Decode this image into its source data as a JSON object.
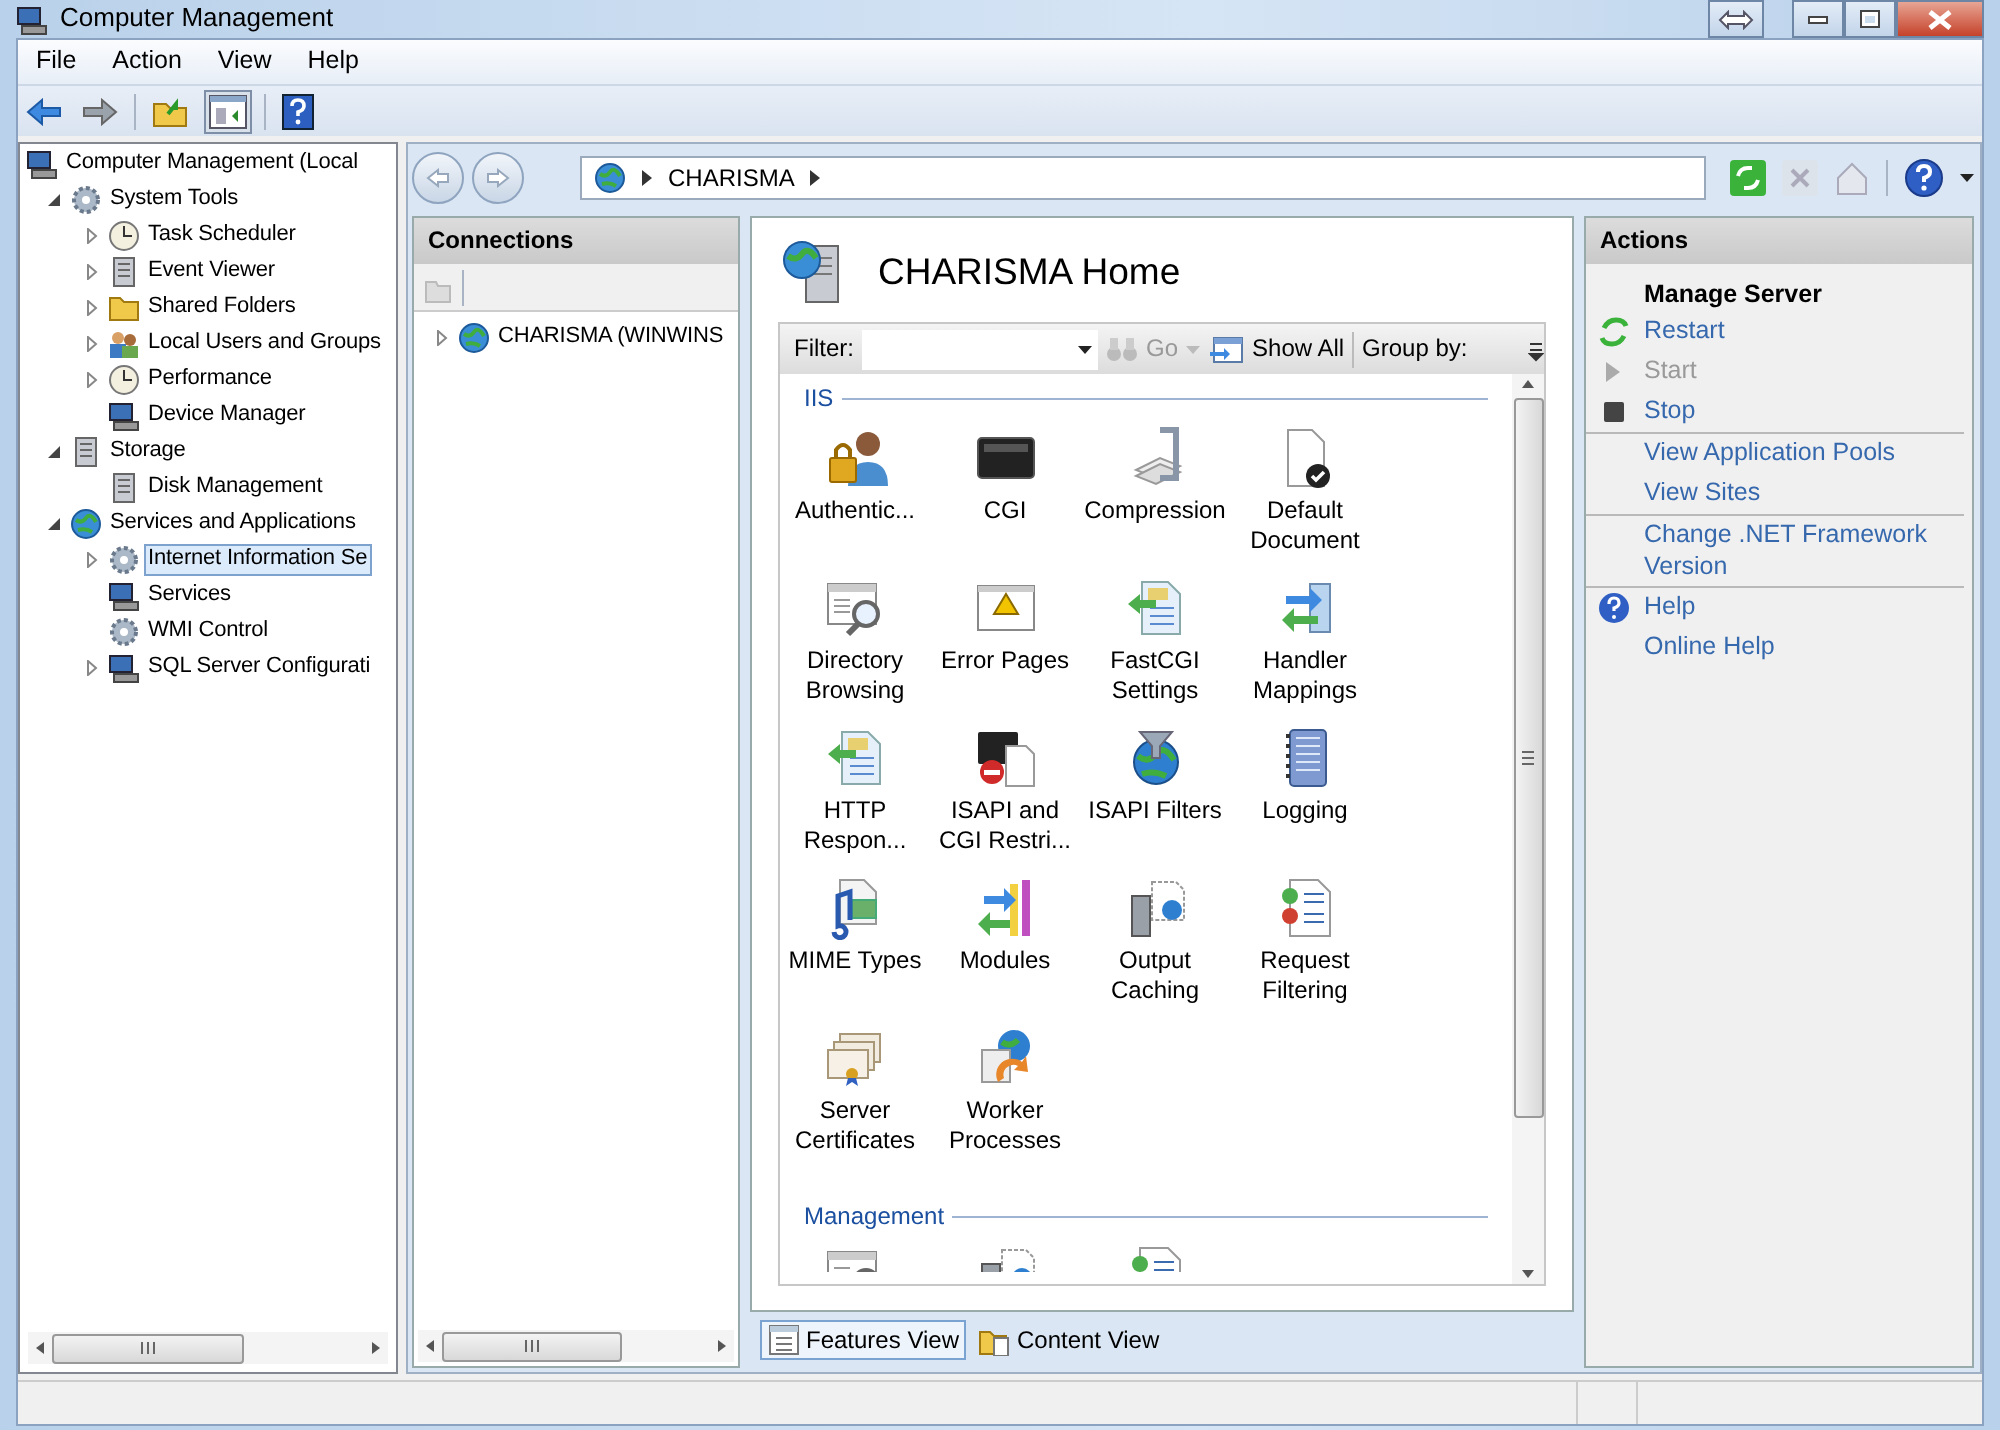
{
  "window": {
    "title": "Computer Management"
  },
  "menu": [
    "File",
    "Action",
    "View",
    "Help"
  ],
  "tree": [
    {
      "label": "Computer Management (Local",
      "selected": false,
      "children": [
        {
          "label": "System Tools",
          "expanded": true,
          "selected": false,
          "children": [
            {
              "label": "Task Scheduler",
              "expanded": false,
              "selected": false
            },
            {
              "label": "Event Viewer",
              "expanded": false,
              "selected": false
            },
            {
              "label": "Shared Folders",
              "expanded": false,
              "selected": false
            },
            {
              "label": "Local Users and Groups",
              "expanded": false,
              "selected": false
            },
            {
              "label": "Performance",
              "expanded": false,
              "selected": false
            },
            {
              "label": "Device Manager",
              "selected": false
            }
          ]
        },
        {
          "label": "Storage",
          "expanded": true,
          "selected": false,
          "children": [
            {
              "label": "Disk Management",
              "selected": false
            }
          ]
        },
        {
          "label": "Services and Applications",
          "expanded": true,
          "selected": false,
          "children": [
            {
              "label": "Internet Information Se",
              "expanded": false,
              "selected": true
            },
            {
              "label": "Services",
              "selected": false
            },
            {
              "label": "WMI Control",
              "selected": false
            },
            {
              "label": "SQL Server Configurati",
              "expanded": false,
              "selected": false
            }
          ]
        }
      ]
    }
  ],
  "iis": {
    "breadcrumb": [
      "CHARISMA"
    ],
    "connections": {
      "title": "Connections",
      "tree": [
        {
          "label": "CHARISMA (WINWINS",
          "expanded": false
        }
      ]
    },
    "home": {
      "title": "CHARISMA Home",
      "filter_label": "Filter:",
      "go": "Go",
      "show_all": "Show All",
      "group_by": "Group by:",
      "groups": [
        {
          "title": "IIS",
          "features": [
            {
              "label": "Authentic..."
            },
            {
              "label": "CGI"
            },
            {
              "label": "Compression"
            },
            {
              "label": "Default\nDocument"
            },
            {
              "label": "Directory\nBrowsing"
            },
            {
              "label": "Error Pages"
            },
            {
              "label": "FastCGI\nSettings"
            },
            {
              "label": "Handler\nMappings"
            },
            {
              "label": "HTTP\nRespon..."
            },
            {
              "label": "ISAPI and\nCGI Restri..."
            },
            {
              "label": "ISAPI Filters"
            },
            {
              "label": "Logging"
            },
            {
              "label": "MIME Types"
            },
            {
              "label": "Modules"
            },
            {
              "label": "Output\nCaching"
            },
            {
              "label": "Request\nFiltering"
            },
            {
              "label": "Server\nCertificates"
            },
            {
              "label": "Worker\nProcesses"
            }
          ]
        },
        {
          "title": "Management",
          "features": [
            {
              "kind": "cut"
            },
            {
              "kind": "cut"
            },
            {
              "kind": "cut"
            }
          ]
        }
      ]
    },
    "views": [
      {
        "label": "Features View",
        "selected": true
      },
      {
        "label": "Content View",
        "selected": false
      }
    ],
    "actions": {
      "title": "Actions",
      "sections": [
        {
          "heading": "Manage Server",
          "items": [
            {
              "label": "Restart",
              "kind": "restart",
              "disabled": false
            },
            {
              "label": "Start",
              "kind": "start",
              "disabled": true
            },
            {
              "label": "Stop",
              "kind": "stop",
              "disabled": false
            }
          ]
        },
        {
          "items": [
            {
              "label": "View Application Pools",
              "kind": "link",
              "disabled": false
            },
            {
              "label": "View Sites",
              "kind": "link",
              "disabled": false
            }
          ]
        },
        {
          "items": [
            {
              "label": "Change .NET Framework Version",
              "kind": "link",
              "disabled": false
            }
          ]
        },
        {
          "items": [
            {
              "label": "Help",
              "kind": "help",
              "disabled": false
            },
            {
              "label": "Online Help",
              "kind": "link",
              "disabled": false
            }
          ]
        }
      ]
    }
  }
}
